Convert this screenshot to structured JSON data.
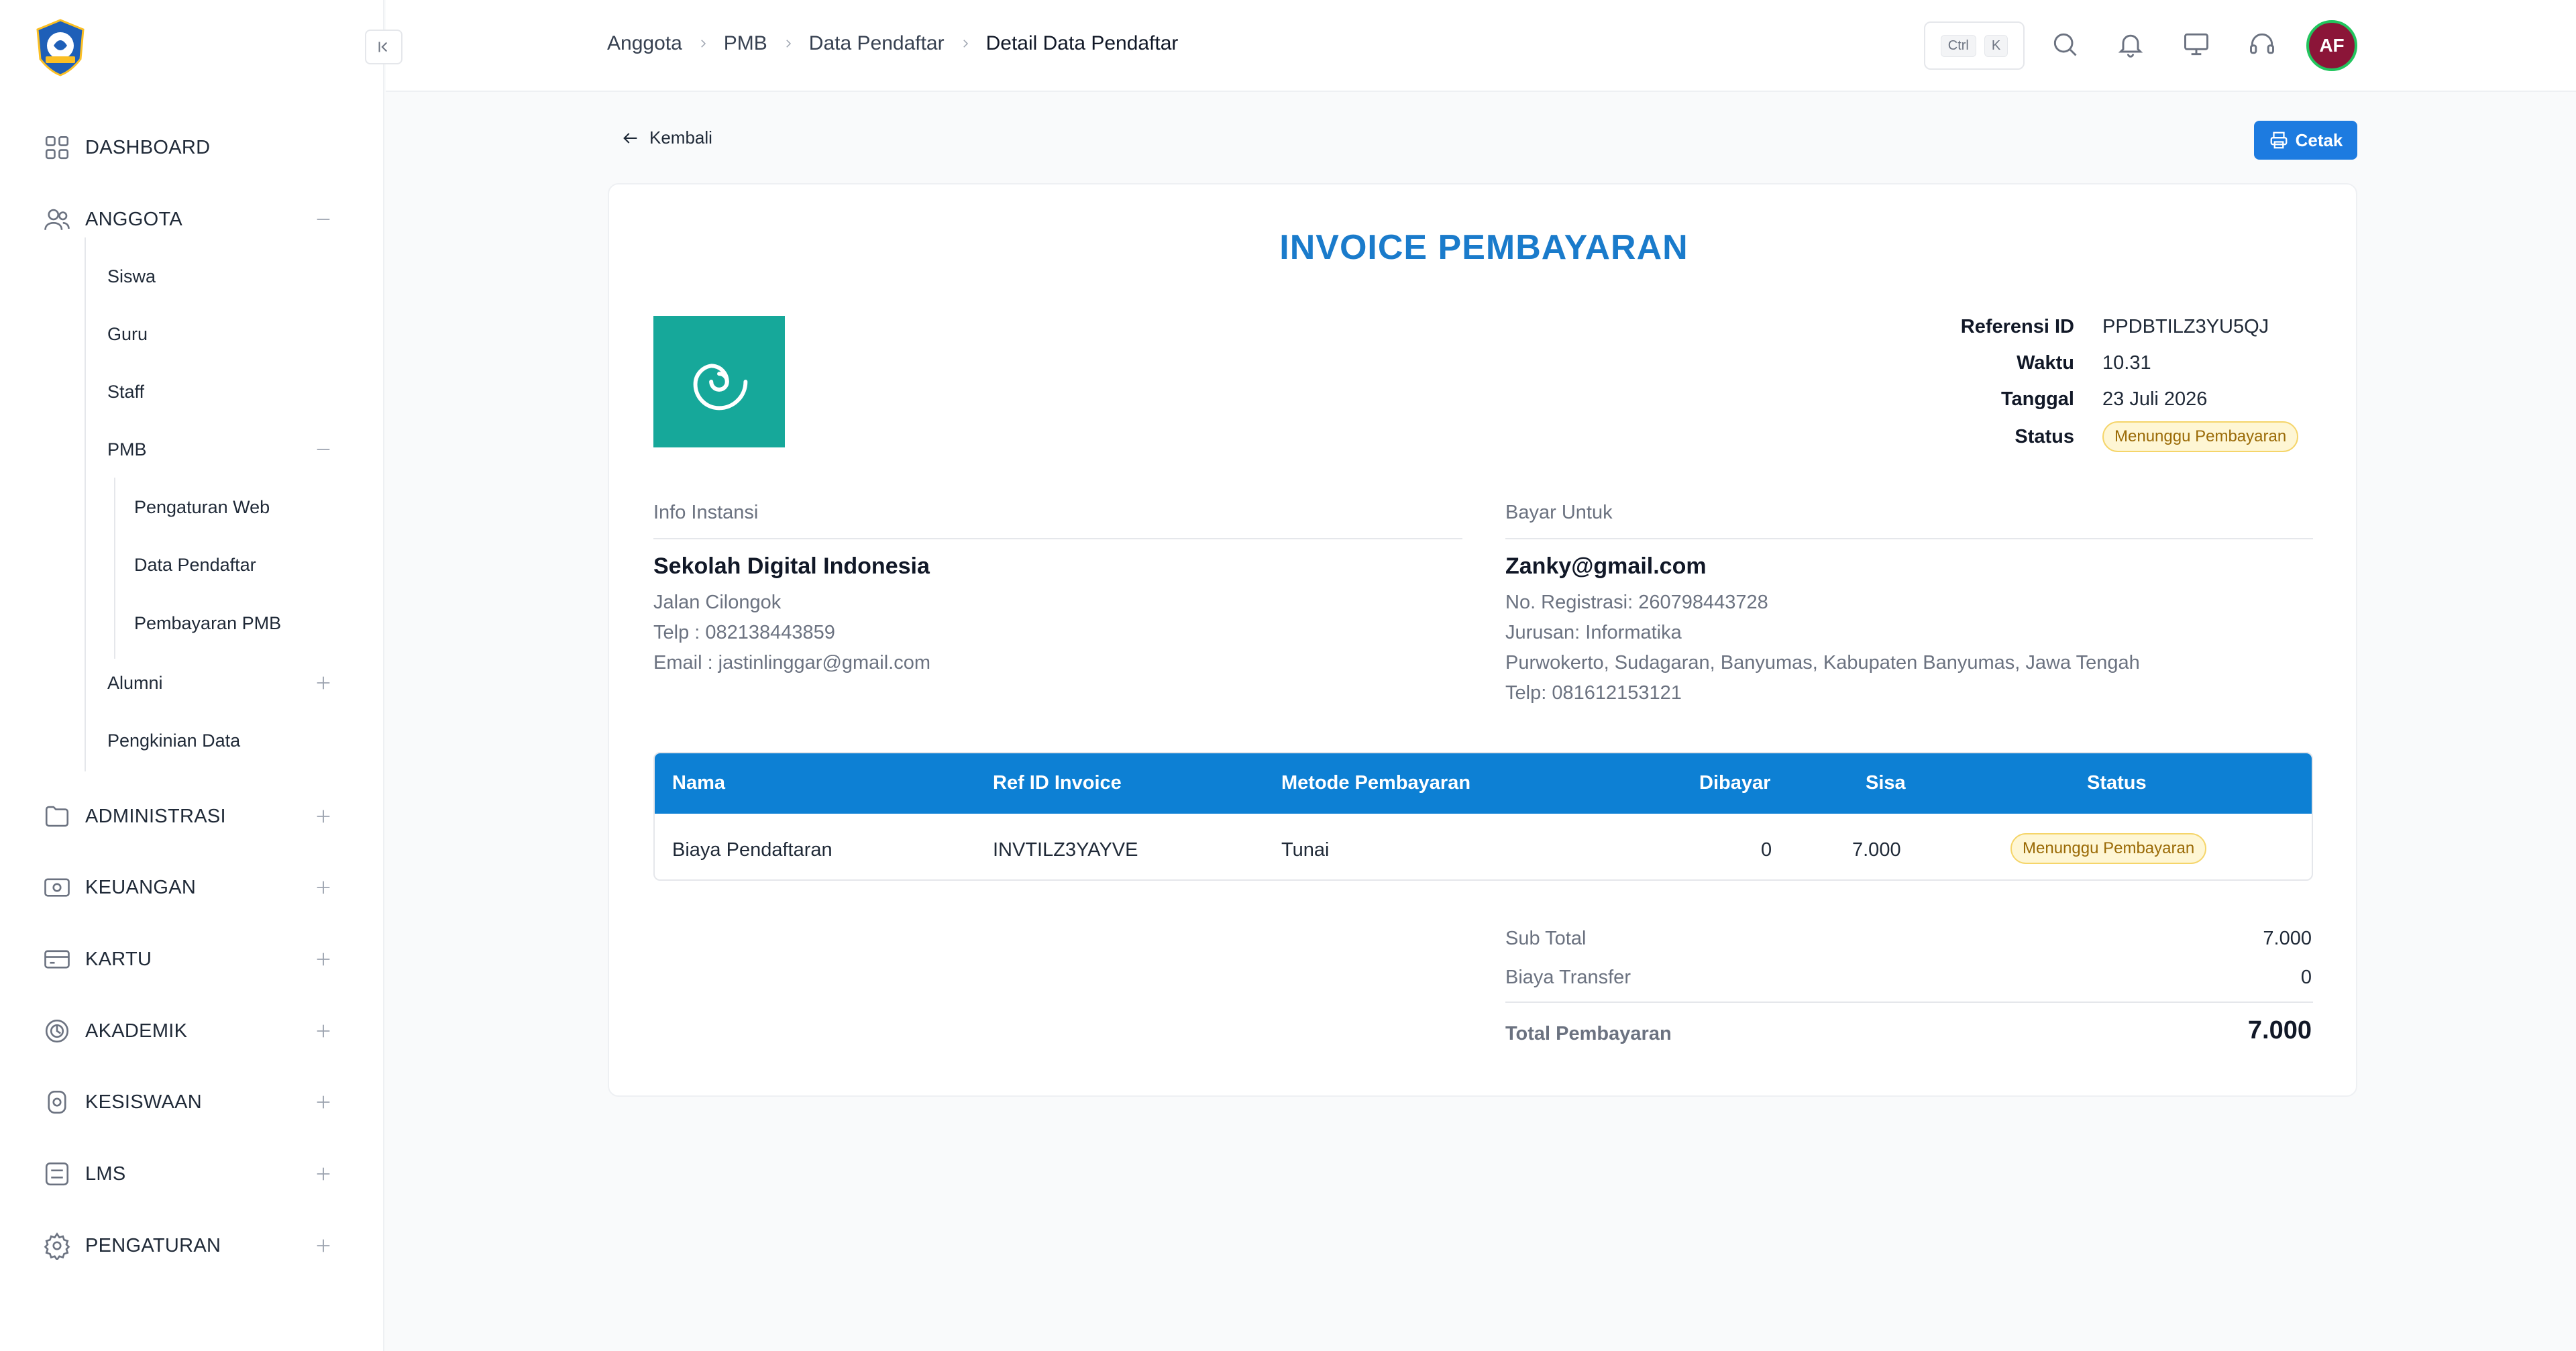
{
  "sidebar": {
    "items": [
      {
        "label": "DASHBOARD",
        "icon": "grid-icon"
      },
      {
        "label": "ANGGOTA",
        "icon": "users-icon",
        "expanded": true
      },
      {
        "label": "ADMINISTRASI",
        "icon": "folder-icon"
      },
      {
        "label": "KEUANGAN",
        "icon": "money-icon"
      },
      {
        "label": "KARTU",
        "icon": "card-icon"
      },
      {
        "label": "AKADEMIK",
        "icon": "academic-icon"
      },
      {
        "label": "KESISWAAN",
        "icon": "student-icon"
      },
      {
        "label": "LMS",
        "icon": "list-icon"
      },
      {
        "label": "PENGATURAN",
        "icon": "gear-icon"
      }
    ],
    "anggota_sub": [
      "Siswa",
      "Guru",
      "Staff",
      "PMB",
      "Alumni",
      "Pengkinian Data"
    ],
    "pmb_sub": [
      "Pengaturan Web",
      "Data Pendaftar",
      "Pembayaran PMB"
    ]
  },
  "topbar": {
    "breadcrumb": [
      "Anggota",
      "PMB",
      "Data Pendaftar",
      "Detail Data Pendaftar"
    ],
    "shortcut": [
      "Ctrl",
      "K"
    ],
    "avatar_initials": "AF"
  },
  "page": {
    "back_label": "Kembali",
    "print_label": "Cetak"
  },
  "invoice": {
    "title": "INVOICE PEMBAYARAN",
    "meta": {
      "ref_label": "Referensi ID",
      "ref_value": "PPDBTILZ3YU5QJ",
      "time_label": "Waktu",
      "time_value": "10.31",
      "date_label": "Tanggal",
      "date_value": "23 Juli 2026",
      "status_label": "Status",
      "status_value": "Menunggu Pembayaran"
    },
    "institution": {
      "heading": "Info Instansi",
      "name": "Sekolah Digital Indonesia",
      "address": "Jalan Cilongok",
      "phone": "Telp : 082138443859",
      "email": "Email : jastinlinggar@gmail.com"
    },
    "payer": {
      "heading": "Bayar Untuk",
      "email": "Zanky@gmail.com",
      "registration": "No. Registrasi: 260798443728",
      "major": "Jurusan: Informatika",
      "address": "Purwokerto, Sudagaran, Banyumas, Kabupaten Banyumas, Jawa Tengah",
      "phone": "Telp: 081612153121"
    },
    "table": {
      "headers": [
        "Nama",
        "Ref ID Invoice",
        "Metode Pembayaran",
        "Dibayar",
        "Sisa",
        "Status"
      ],
      "rows": [
        {
          "name": "Biaya Pendaftaran",
          "ref": "INVTILZ3YAYVE",
          "method": "Tunai",
          "paid": "0",
          "remaining": "7.000",
          "status": "Menunggu Pembayaran"
        }
      ]
    },
    "summary": {
      "subtotal_label": "Sub Total",
      "subtotal_value": "7.000",
      "transfer_label": "Biaya Transfer",
      "transfer_value": "0",
      "total_label": "Total Pembayaran",
      "total_value": "7.000"
    }
  },
  "colors": {
    "accent": "#1a7bcb",
    "table_header": "#0d80d4",
    "print_button": "#1d7be0",
    "logo_bg": "#16a89a",
    "badge_bg": "#fef6d4",
    "avatar_bg": "#8b1538"
  }
}
